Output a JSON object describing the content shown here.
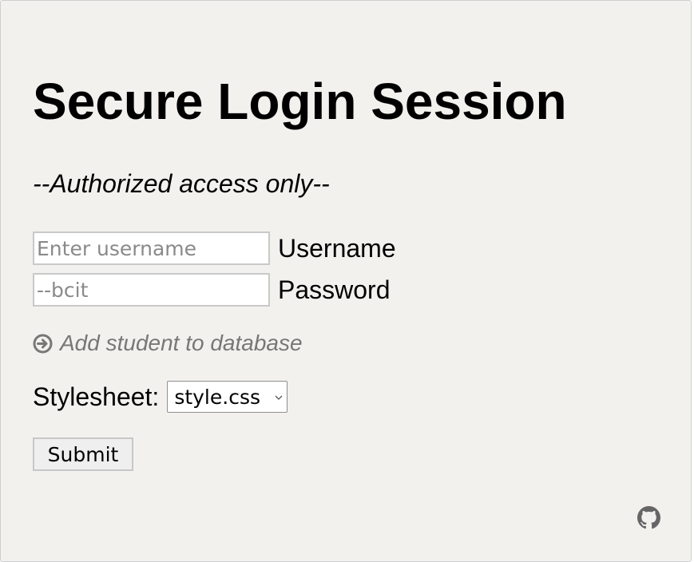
{
  "page": {
    "title": "Secure Login Session",
    "subtitle": "--Authorized access only--"
  },
  "form": {
    "username": {
      "placeholder": "Enter username",
      "value": "",
      "label": "Username"
    },
    "password": {
      "placeholder": "--bcit",
      "value": "",
      "label": "Password"
    },
    "add_student_link": {
      "label": "Add student to database",
      "icon": "circle-arrow-right-icon"
    },
    "stylesheet": {
      "label": "Stylesheet:",
      "selected": "style.css"
    },
    "submit_label": "Submit"
  },
  "footer": {
    "icon": "github-icon"
  },
  "colors": {
    "background": "#f3f1ee",
    "link": "#777777",
    "github": "#666666"
  }
}
